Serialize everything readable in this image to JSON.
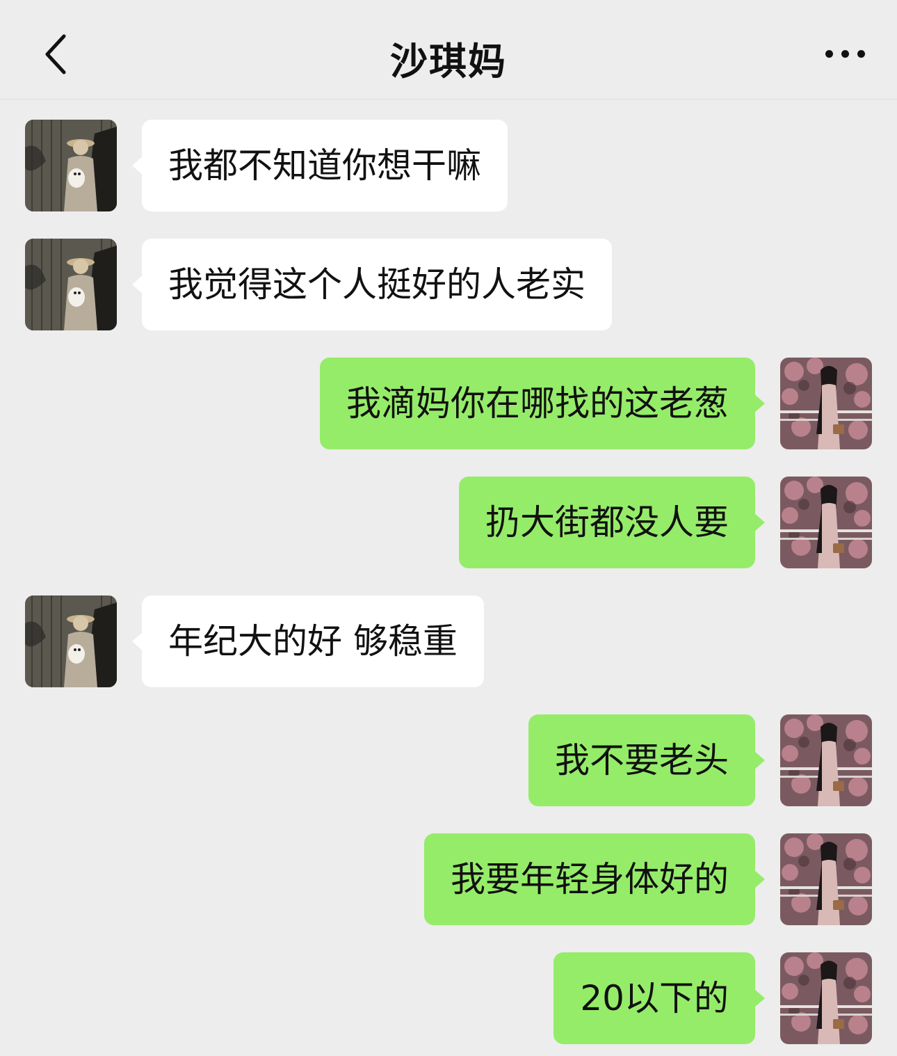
{
  "header": {
    "title": "沙琪妈",
    "back_icon": "chevron-left-icon",
    "more_icon": "more-dots-icon"
  },
  "messages": [
    {
      "side": "left",
      "text": "我都不知道你想干嘛"
    },
    {
      "side": "left",
      "text": "我觉得这个人挺好的人老实"
    },
    {
      "side": "right",
      "text": "我滴妈你在哪找的这老葱"
    },
    {
      "side": "right",
      "text": "扔大街都没人要"
    },
    {
      "side": "left",
      "text": "年纪大的好 够稳重"
    },
    {
      "side": "right",
      "text": "我不要老头"
    },
    {
      "side": "right",
      "text": "我要年轻身体好的"
    },
    {
      "side": "right",
      "text": "20以下的"
    }
  ],
  "colors": {
    "background": "#ededed",
    "incoming_bubble": "#ffffff",
    "outgoing_bubble": "#95ec69"
  }
}
